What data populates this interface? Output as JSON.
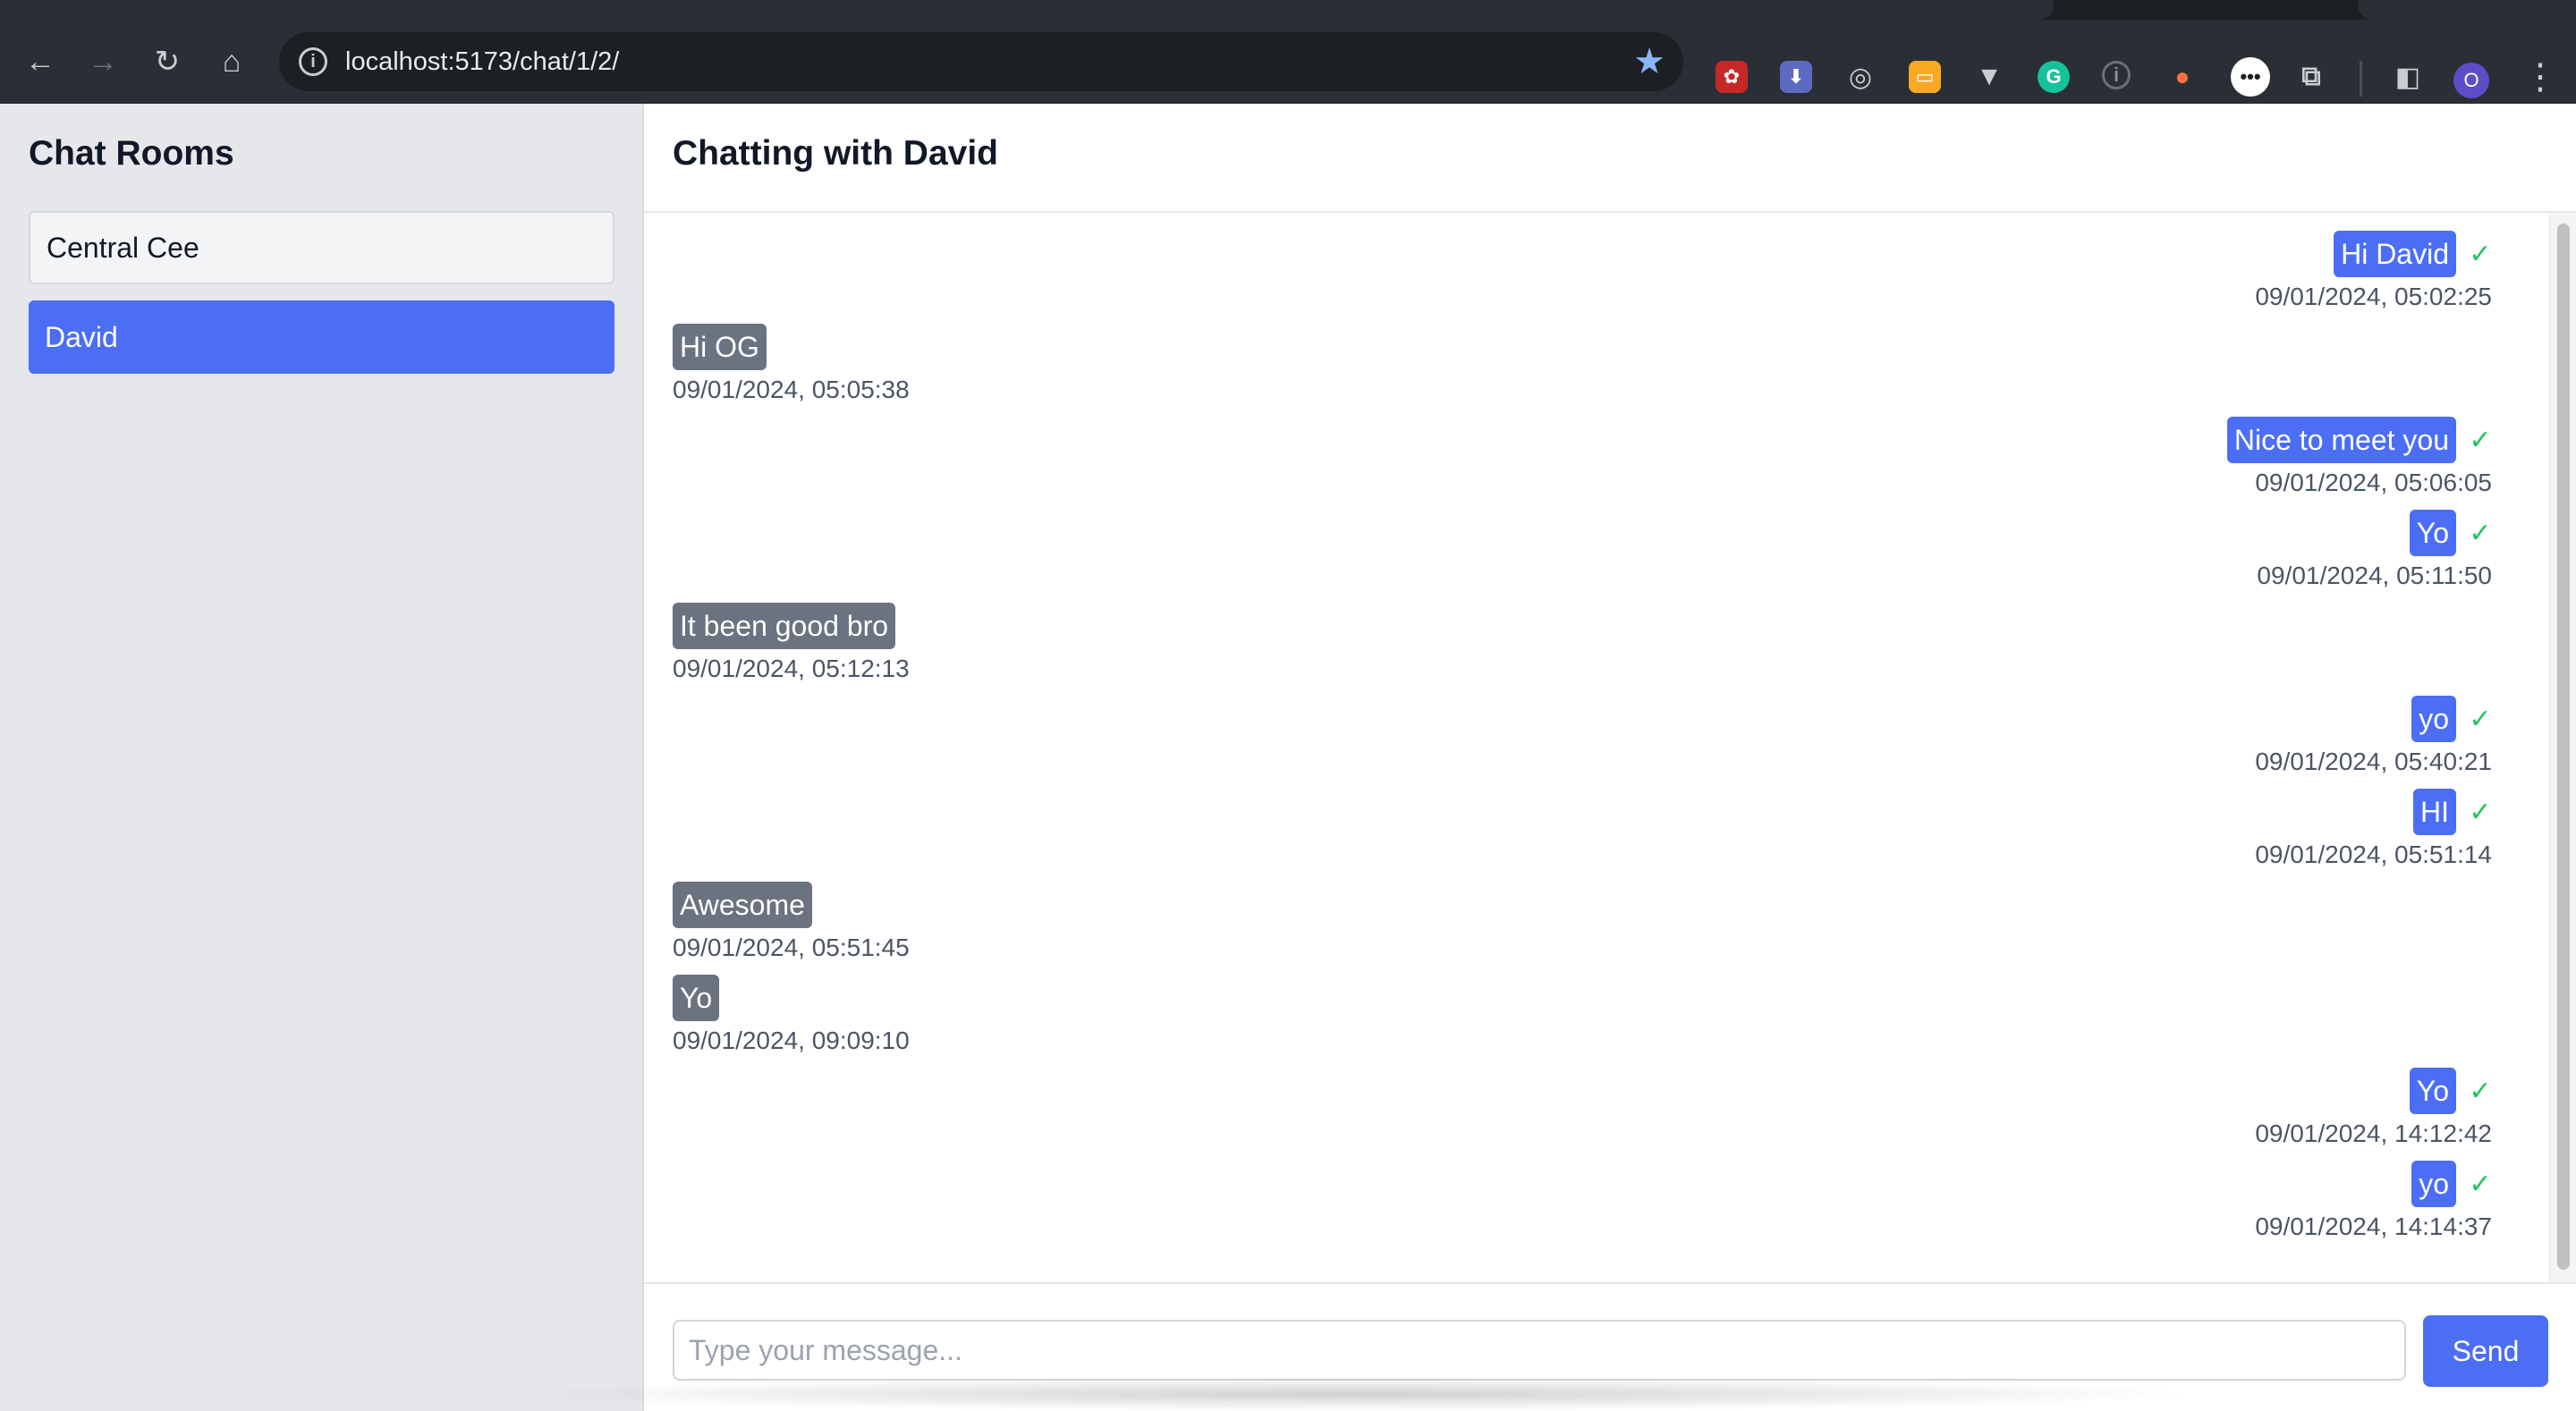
{
  "browser": {
    "url": "localhost:5173/chat/1/2/",
    "nav": {
      "back_icon": "back-arrow-icon",
      "forward_icon": "forward-arrow-icon",
      "reload_icon": "reload-icon",
      "home_icon": "home-icon"
    },
    "profile_initial": "O",
    "extensions": [
      "extension-red-icon",
      "extension-download-icon",
      "extension-target-icon",
      "extension-ticket-icon",
      "extension-v-icon",
      "grammarly-icon",
      "extension-info-icon",
      "extension-dot-icon",
      "extension-chat-icon",
      "puzzle-icon"
    ]
  },
  "sidebar": {
    "title": "Chat Rooms",
    "rooms": [
      {
        "label": "Central Cee",
        "active": false
      },
      {
        "label": "David",
        "active": true
      }
    ]
  },
  "chat": {
    "title": "Chatting with David",
    "messages": [
      {
        "text": "Hi David",
        "time": "09/01/2024, 05:02:25",
        "sent": true
      },
      {
        "text": "Hi OG",
        "time": "09/01/2024, 05:05:38",
        "sent": false
      },
      {
        "text": "Nice to meet you",
        "time": "09/01/2024, 05:06:05",
        "sent": true
      },
      {
        "text": "Yo",
        "time": "09/01/2024, 05:11:50",
        "sent": true
      },
      {
        "text": "It been good bro",
        "time": "09/01/2024, 05:12:13",
        "sent": false
      },
      {
        "text": "yo",
        "time": "09/01/2024, 05:40:21",
        "sent": true
      },
      {
        "text": "HI",
        "time": "09/01/2024, 05:51:14",
        "sent": true
      },
      {
        "text": "Awesome",
        "time": "09/01/2024, 05:51:45",
        "sent": false
      },
      {
        "text": "Yo",
        "time": "09/01/2024, 09:09:10",
        "sent": false
      },
      {
        "text": "Yo",
        "time": "09/01/2024, 14:12:42",
        "sent": true
      },
      {
        "text": "yo",
        "time": "09/01/2024, 14:14:37",
        "sent": true
      }
    ],
    "read_mark": "✓"
  },
  "composer": {
    "placeholder": "Type your message...",
    "value": "",
    "send_label": "Send"
  },
  "colors": {
    "accent": "#4c6ef5",
    "incoming_bubble": "#6b7280",
    "read_check": "#22c55e",
    "sidebar_bg": "#e5e7eb"
  }
}
